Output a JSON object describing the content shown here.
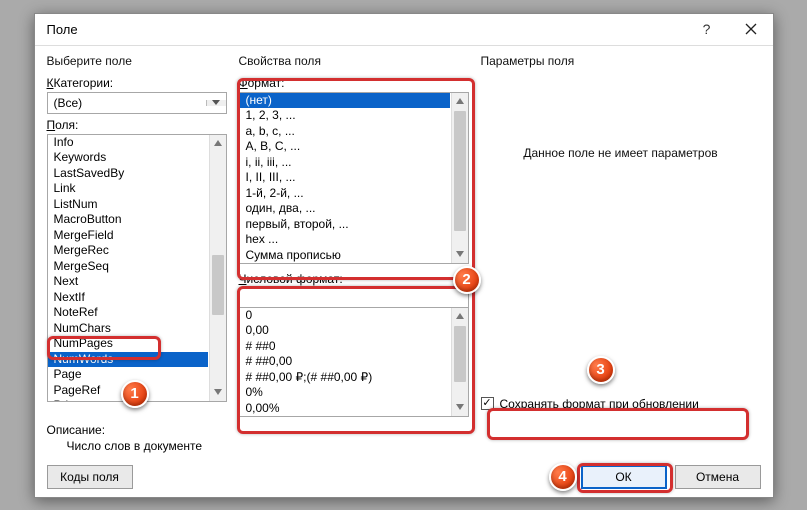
{
  "dialog": {
    "title": "Поле"
  },
  "left": {
    "group_title": "Выберите поле",
    "categories_label_html": "Категории:",
    "categories_u": "К",
    "category_value": "(Все)",
    "fields_label_html": "оля:",
    "fields_u": "П",
    "fields": [
      "Info",
      "Keywords",
      "LastSavedBy",
      "Link",
      "ListNum",
      "MacroButton",
      "MergeField",
      "MergeRec",
      "MergeSeq",
      "Next",
      "NextIf",
      "NoteRef",
      "NumChars",
      "NumPages",
      "NumWords",
      "Page",
      "PageRef",
      "Print"
    ],
    "selected_index": 14,
    "description_label": "Описание:",
    "description_value": "Число слов в документе",
    "codes_button": "Коды поля"
  },
  "mid": {
    "group_title": "Свойства поля",
    "format_label_html": "ормат:",
    "format_u": "Ф",
    "formats": [
      "(нет)",
      "1, 2, 3, ...",
      "a, b, c, ...",
      "A, B, C, ...",
      "i, ii, iii, ...",
      "I, II, III, ...",
      "1-й, 2-й, ...",
      "один, два, ...",
      "первый, второй, ...",
      "hex ...",
      "Сумма прописью"
    ],
    "format_selected_index": 0,
    "numeric_label_html": "исловой формат:",
    "numeric_u": "Ч",
    "numeric_value": "",
    "numeric_formats": [
      "0",
      "0,00",
      "# ##0",
      "# ##0,00",
      "# ##0,00 ₽;(# ##0,00 ₽)",
      "0%",
      "0,00%"
    ]
  },
  "right": {
    "group_title": "Параметры поля",
    "no_params_message": "Данное поле не имеет параметров",
    "preserve_label": "Сохранять формат при обновлении",
    "preserve_checked": true
  },
  "footer": {
    "ok": "ОК",
    "cancel": "Отмена"
  },
  "annotations": {
    "b1": "1",
    "b2": "2",
    "b3": "3",
    "b4": "4"
  }
}
